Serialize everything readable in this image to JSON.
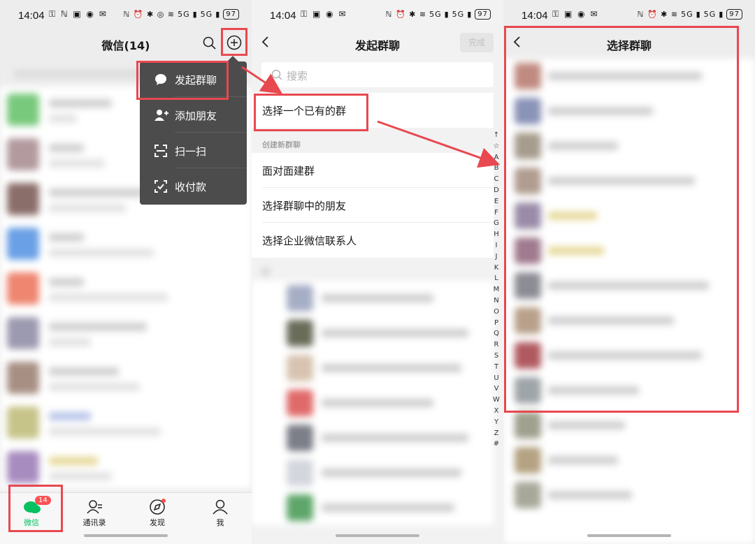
{
  "status_time": "14:04",
  "status_battery": "97",
  "status_network": "5G",
  "panel1": {
    "title": "微信(14)",
    "menu": [
      {
        "label": "发起群聊",
        "icon": "chat-bubble-icon"
      },
      {
        "label": "添加朋友",
        "icon": "add-user-icon"
      },
      {
        "label": "扫一扫",
        "icon": "scan-icon"
      },
      {
        "label": "收付款",
        "icon": "payment-icon"
      }
    ],
    "tabs": [
      {
        "label": "微信",
        "icon": "chat-icon"
      },
      {
        "label": "通讯录",
        "icon": "contacts-icon"
      },
      {
        "label": "发现",
        "icon": "discover-icon"
      },
      {
        "label": "我",
        "icon": "me-icon"
      }
    ],
    "badge": "14"
  },
  "panel2": {
    "title": "发起群聊",
    "done": "完成",
    "search_placeholder": "搜索",
    "option_existing": "选择一个已有的群",
    "section_new": "创建新群聊",
    "option_face": "面对面建群",
    "option_friends": "选择群聊中的朋友",
    "option_work": "选择企业微信联系人",
    "index": [
      "↑",
      "☆",
      "A",
      "B",
      "C",
      "D",
      "E",
      "F",
      "G",
      "H",
      "I",
      "J",
      "K",
      "L",
      "M",
      "N",
      "O",
      "P",
      "Q",
      "R",
      "S",
      "T",
      "U",
      "V",
      "W",
      "X",
      "Y",
      "Z",
      "#"
    ]
  },
  "panel3": {
    "title": "选择群聊"
  },
  "colors": {
    "accent": "#07c160",
    "annotation": "#e8484f",
    "menu_bg": "#4c4c4c"
  }
}
